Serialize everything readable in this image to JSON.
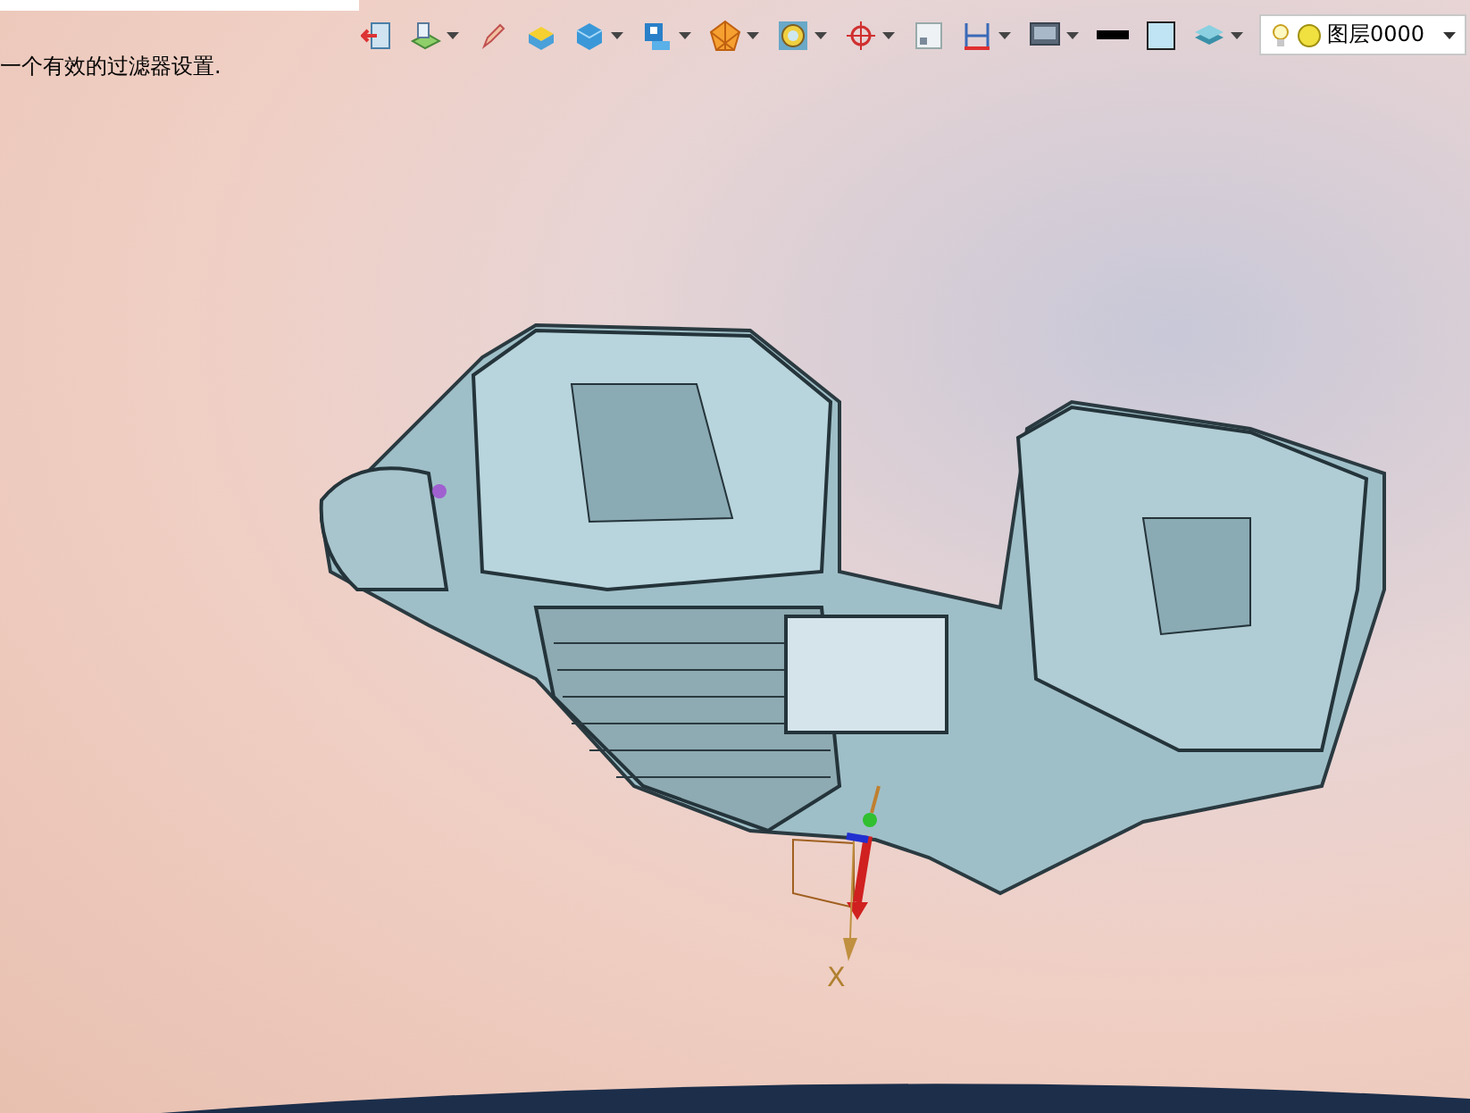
{
  "prompt": "一个有效的过滤器设置.",
  "toolbar": {
    "tools": [
      {
        "kind": "exit",
        "dropdown": false
      },
      {
        "kind": "sheet",
        "dropdown": true
      },
      {
        "kind": "pencil",
        "dropdown": false
      },
      {
        "kind": "block",
        "dropdown": false
      },
      {
        "kind": "cube",
        "dropdown": true
      },
      {
        "kind": "view",
        "dropdown": true
      },
      {
        "kind": "polygon",
        "dropdown": true
      },
      {
        "kind": "ring",
        "dropdown": true
      },
      {
        "kind": "target",
        "dropdown": true
      },
      {
        "kind": "window",
        "dropdown": false
      },
      {
        "kind": "dimension",
        "dropdown": true
      },
      {
        "kind": "monitor",
        "dropdown": true
      },
      {
        "kind": "line",
        "dropdown": false
      },
      {
        "kind": "swatch",
        "dropdown": false
      },
      {
        "kind": "layers",
        "dropdown": true
      }
    ]
  },
  "layer_selector": {
    "value": "图层0000"
  },
  "triad": {
    "axis_label": "X"
  }
}
